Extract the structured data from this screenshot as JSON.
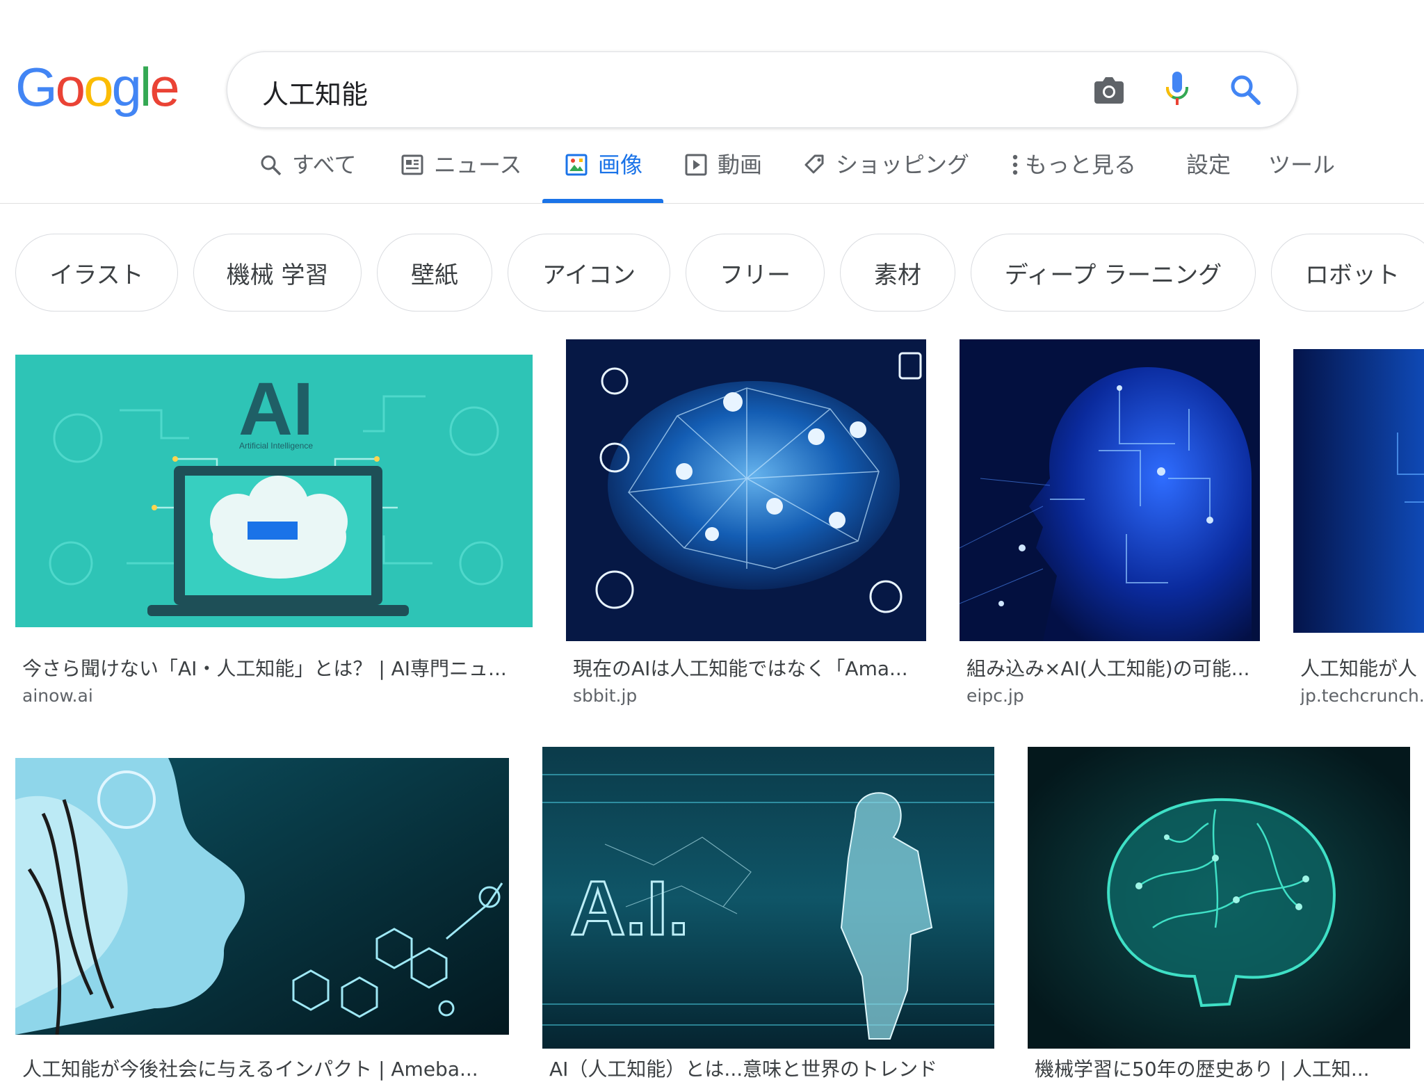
{
  "logo": {
    "letters": [
      "G",
      "o",
      "o",
      "g",
      "l",
      "e"
    ],
    "colors": [
      "#4285F4",
      "#EA4335",
      "#FBBC05",
      "#4285F4",
      "#34A853",
      "#EA4335"
    ]
  },
  "search": {
    "query": "人工知能"
  },
  "tabs": [
    {
      "label": "すべて",
      "icon": "search-icon",
      "active": false
    },
    {
      "label": "ニュース",
      "icon": "news-icon",
      "active": false
    },
    {
      "label": "画像",
      "icon": "image-icon",
      "active": true
    },
    {
      "label": "動画",
      "icon": "video-icon",
      "active": false
    },
    {
      "label": "ショッピング",
      "icon": "tag-icon",
      "active": false
    },
    {
      "label": "もっと見る",
      "icon": "more-vertical-icon",
      "active": false
    },
    {
      "label": "設定",
      "icon": "",
      "active": false
    },
    {
      "label": "ツール",
      "icon": "",
      "active": false
    }
  ],
  "chips": [
    "イラスト",
    "機械 学習",
    "壁紙",
    "アイコン",
    "フリー",
    "素材",
    "ディープ ラーニング",
    "ロボット"
  ],
  "results": [
    {
      "title": "今さら聞けない「AI・人工知能」とは？ | AI専門ニュ...",
      "source": "ainow.ai"
    },
    {
      "title": "現在のAIは人工知能ではなく「Ama...",
      "source": "sbbit.jp"
    },
    {
      "title": "組み込み×AI(人工知能)の可能...",
      "source": "eipc.jp"
    },
    {
      "title": "人工知能が人",
      "source": "jp.techcrunch.c"
    },
    {
      "title": "人工知能が今後社会に与えるインパクト | Ameba...",
      "source": ""
    },
    {
      "title": "AI（人工知能）とは...意味と世界のトレンド",
      "source": ""
    },
    {
      "title": "機械学習に50年の歴史あり | 人工知...",
      "source": ""
    }
  ],
  "thumb_text": {
    "ai_logo": "AI",
    "ai_sub": "Artificial Intelligence",
    "ai_text": "A.I."
  },
  "colors": {
    "accent": "#1a73e8",
    "chip_border": "#dadce0",
    "text_secondary": "#5f6368"
  }
}
